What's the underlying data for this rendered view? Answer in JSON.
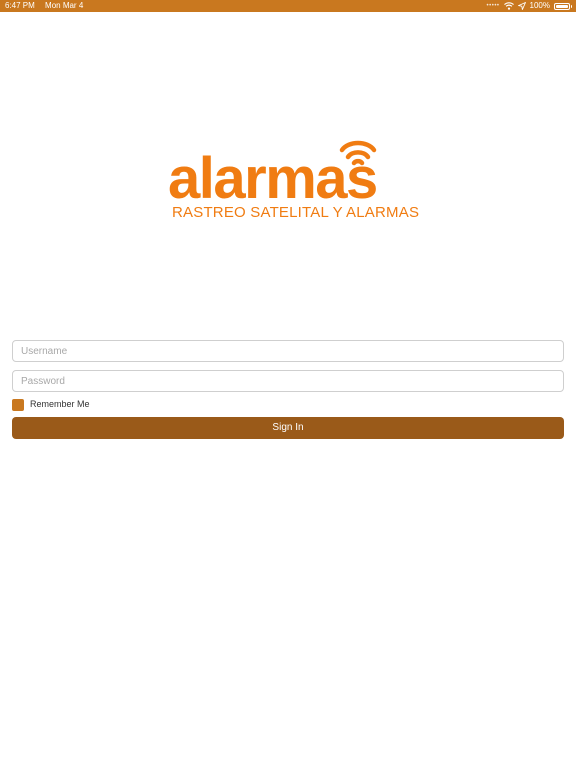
{
  "status_bar": {
    "time": "6:47 PM",
    "date": "Mon Mar 4",
    "signal": "•••••",
    "battery_percent": "100%",
    "battery_level": 1.0,
    "icons": [
      "wifi-icon",
      "location-arrow-icon",
      "battery-icon"
    ]
  },
  "logo": {
    "wordmark": "alarmas",
    "tagline": "RASTREO SATELITAL Y ALARMAS",
    "icon": "signal-waves-icon"
  },
  "form": {
    "username_placeholder": "Username",
    "username_value": "",
    "password_placeholder": "Password",
    "password_value": "",
    "remember_label": "Remember Me",
    "remember_checked": false,
    "sign_in_label": "Sign In"
  },
  "colors": {
    "status_bar": "#c9781f",
    "logo_orange": "#f07c12",
    "checkbox": "#c9781f",
    "button": "#9a5a19"
  }
}
